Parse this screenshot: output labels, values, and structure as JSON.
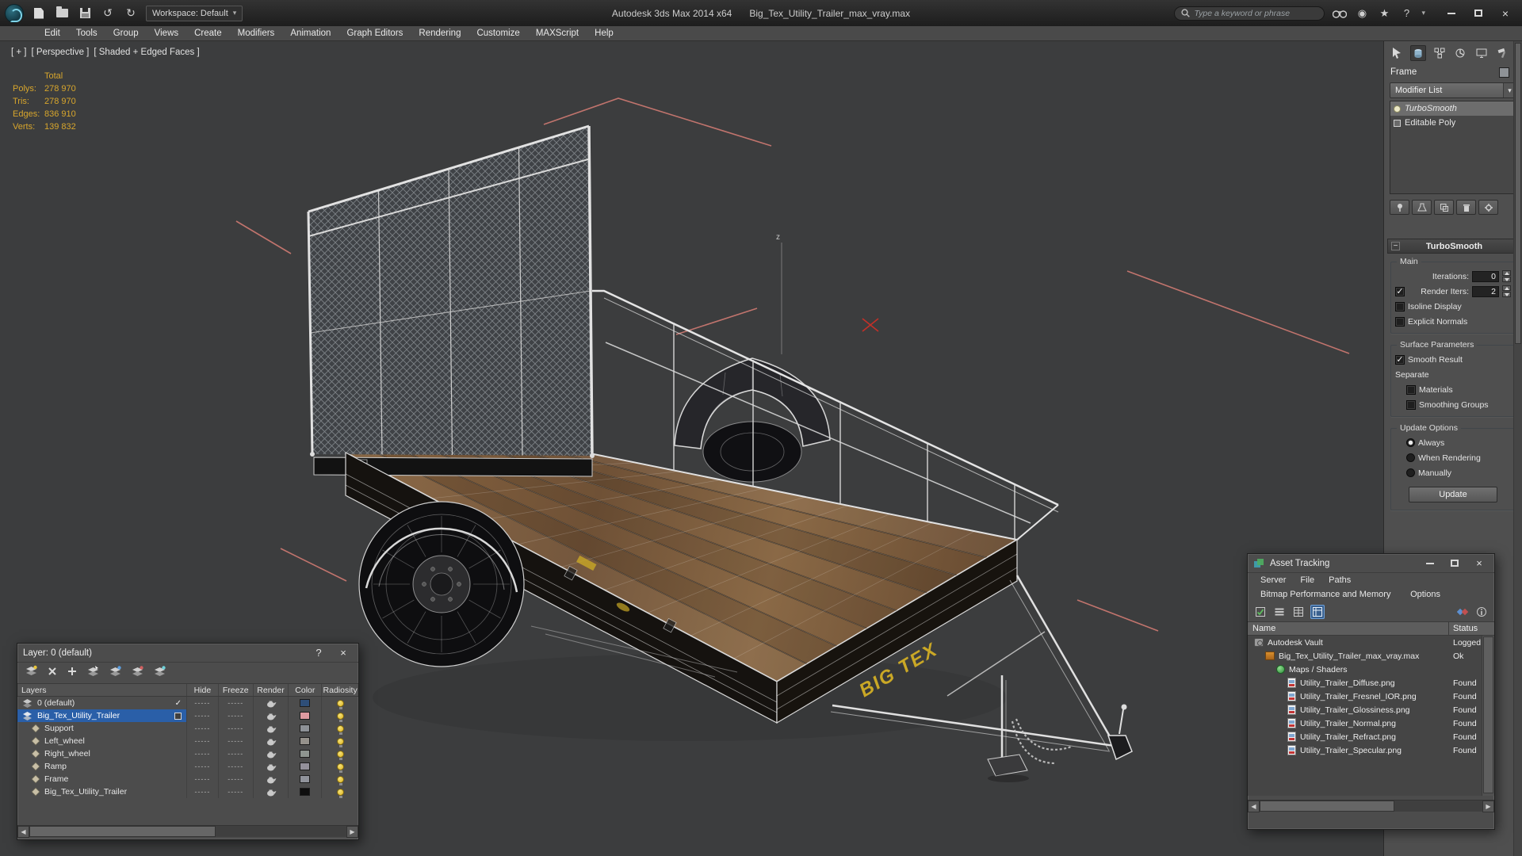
{
  "titlebar": {
    "workspace": "Workspace: Default",
    "app_title": "Autodesk 3ds Max 2014 x64",
    "doc_title": "Big_Tex_Utility_Trailer_max_vray.max",
    "search_placeholder": "Type a keyword or phrase"
  },
  "menubar": {
    "items": [
      "Edit",
      "Tools",
      "Group",
      "Views",
      "Create",
      "Modifiers",
      "Animation",
      "Graph Editors",
      "Rendering",
      "Customize",
      "MAXScript",
      "Help"
    ]
  },
  "viewport": {
    "mode_general": "[ + ]",
    "mode_view": "[ Perspective ]",
    "mode_shading": "[ Shaded + Edged Faces ]",
    "stats": {
      "total_label": "Total",
      "rows": [
        {
          "label": "Polys:",
          "value": "278 970"
        },
        {
          "label": "Tris:",
          "value": "278 970"
        },
        {
          "label": "Edges:",
          "value": "836 910"
        },
        {
          "label": "Verts:",
          "value": "139 832"
        }
      ]
    },
    "axis_label": "z",
    "trailer_decal": "BIG TEX"
  },
  "command_panel": {
    "object_name": "Frame",
    "modifier_list": "Modifier List",
    "stack": [
      {
        "label": "TurboSmooth"
      },
      {
        "label": "Editable Poly"
      }
    ],
    "turbosmooth": {
      "title": "TurboSmooth",
      "group_main": "Main",
      "iterations_label": "Iterations:",
      "iterations_value": "0",
      "render_iters_label": "Render Iters:",
      "render_iters_value": "2",
      "isoline_display": "Isoline Display",
      "explicit_normals": "Explicit Normals",
      "group_surface": "Surface Parameters",
      "smooth_result": "Smooth Result",
      "separate_label": "Separate",
      "materials": "Materials",
      "smoothing_groups": "Smoothing Groups",
      "group_update": "Update Options",
      "always": "Always",
      "when_rendering": "When Rendering",
      "manually": "Manually",
      "update_button": "Update"
    }
  },
  "layer_window": {
    "title": "Layer: 0 (default)",
    "dash": "-----",
    "columns": [
      "Layers",
      "Hide",
      "Freeze",
      "Render",
      "Color",
      "Radiosity"
    ],
    "rows": [
      {
        "name": "0 (default)",
        "color": "#2e4e78"
      },
      {
        "name": "Big_Tex_Utility_Trailer",
        "color": "#de9aa0"
      },
      {
        "name": "Support",
        "color": "#8d9196"
      },
      {
        "name": "Left_wheel",
        "color": "#95918b"
      },
      {
        "name": "Right_wheel",
        "color": "#8e9590"
      },
      {
        "name": "Ramp",
        "color": "#93909a"
      },
      {
        "name": "Frame",
        "color": "#90939b"
      },
      {
        "name": "Big_Tex_Utility_Trailer",
        "color": "#0e0e0e"
      }
    ]
  },
  "asset_window": {
    "title": "Asset Tracking",
    "menu": [
      "Server",
      "File",
      "Paths"
    ],
    "menu2": [
      "Bitmap Performance and Memory",
      "Options"
    ],
    "columns": [
      "Name",
      "Status"
    ],
    "rows": [
      {
        "name": "Autodesk Vault",
        "status": "Logged O"
      },
      {
        "name": "Big_Tex_Utility_Trailer_max_vray.max",
        "status": "Ok"
      },
      {
        "name": "Maps / Shaders",
        "status": ""
      },
      {
        "name": "Utility_Trailer_Diffuse.png",
        "status": "Found"
      },
      {
        "name": "Utility_Trailer_Fresnel_IOR.png",
        "status": "Found"
      },
      {
        "name": "Utility_Trailer_Glossiness.png",
        "status": "Found"
      },
      {
        "name": "Utility_Trailer_Normal.png",
        "status": "Found"
      },
      {
        "name": "Utility_Trailer_Refract.png",
        "status": "Found"
      },
      {
        "name": "Utility_Trailer_Specular.png",
        "status": "Found"
      }
    ]
  },
  "icons": {
    "close": "×",
    "caret": "▾",
    "star": "★",
    "help": "?",
    "check": "✓",
    "scroll_left": "◀",
    "scroll_right": "▶",
    "undo": "↺",
    "redo": "↻"
  }
}
